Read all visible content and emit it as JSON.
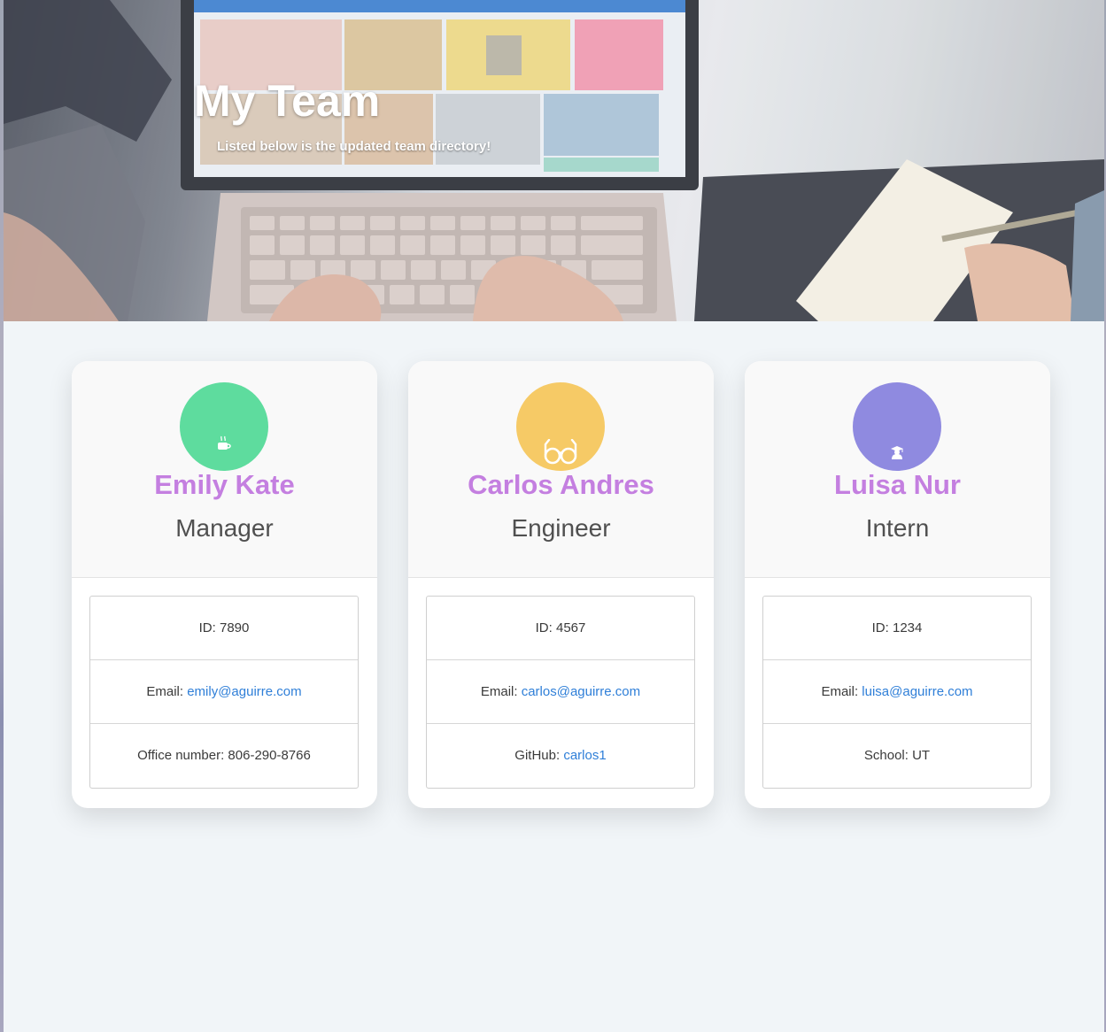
{
  "header": {
    "title": "My Team",
    "subtitle": "Listed below is the updated team directory!"
  },
  "colors": {
    "name": "#c47fe0",
    "link": "#2f7fd8",
    "manager_avatar": "#5edc9e",
    "engineer_avatar": "#f6ca66",
    "intern_avatar": "#8f8ae0"
  },
  "team": [
    {
      "name": "Emily Kate",
      "role": "Manager",
      "icon": "coffee-mug-icon",
      "id_label": "ID: 7890",
      "email_label": "Email: ",
      "email": "emily@aguirre.com",
      "extra_label": "Office number: ",
      "extra_value": "806-290-8766"
    },
    {
      "name": "Carlos Andres",
      "role": "Engineer",
      "icon": "glasses-icon",
      "id_label": "ID: 4567",
      "email_label": "Email: ",
      "email": "carlos@aguirre.com",
      "extra_label": "GitHub: ",
      "extra_value": "carlos1"
    },
    {
      "name": "Luisa Nur",
      "role": "Intern",
      "icon": "graduate-icon",
      "id_label": "ID: 1234",
      "email_label": "Email: ",
      "email": "luisa@aguirre.com",
      "extra_label": "School: ",
      "extra_value": "UT"
    }
  ]
}
